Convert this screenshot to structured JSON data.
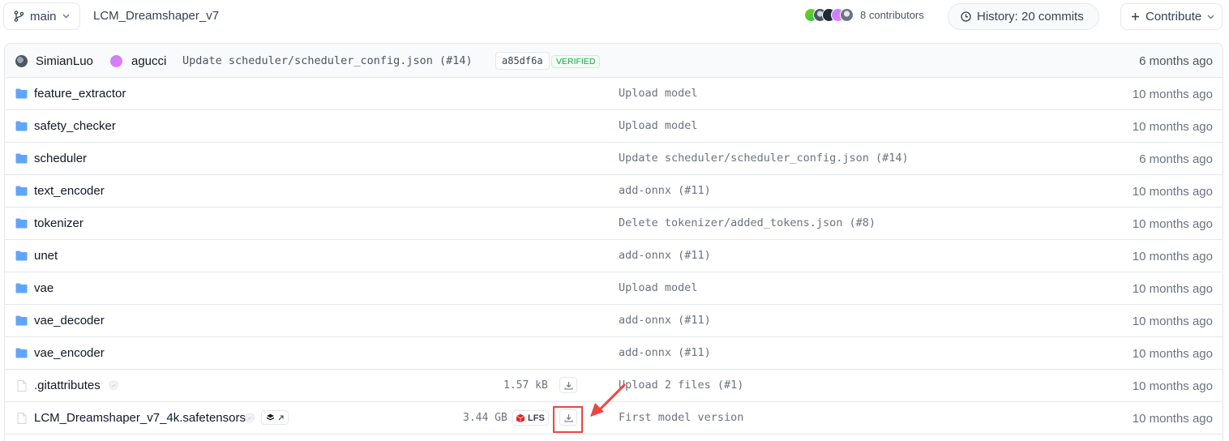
{
  "header": {
    "branch": "main",
    "repo_name": "LCM_Dreamshaper_v7",
    "contributors": "8 contributors",
    "contributor_avatar_colors": [
      "#84cc16",
      "#6b7280",
      "#374151",
      "#c084fc",
      "#6b7280"
    ],
    "history": "History: 20 commits",
    "contribute": "Contribute"
  },
  "last_commit": {
    "author1": "SimianLuo",
    "author2": "agucci",
    "message": "Update scheduler/scheduler_config.json (#14)",
    "hash": "a85df6a",
    "verified": "VERIFIED",
    "time": "6 months ago"
  },
  "folders": [
    {
      "name": "feature_extractor",
      "message": "Upload model",
      "time": "10 months ago"
    },
    {
      "name": "safety_checker",
      "message": "Upload model",
      "time": "10 months ago"
    },
    {
      "name": "scheduler",
      "message": "Update scheduler/scheduler_config.json (#14)",
      "time": "6 months ago"
    },
    {
      "name": "text_encoder",
      "message": "add-onnx (#11)",
      "time": "10 months ago"
    },
    {
      "name": "tokenizer",
      "message": "Delete tokenizer/added_tokens.json (#8)",
      "time": "10 months ago"
    },
    {
      "name": "unet",
      "message": "add-onnx (#11)",
      "time": "10 months ago"
    },
    {
      "name": "vae",
      "message": "Upload model",
      "time": "10 months ago"
    },
    {
      "name": "vae_decoder",
      "message": "add-onnx (#11)",
      "time": "10 months ago"
    },
    {
      "name": "vae_encoder",
      "message": "add-onnx (#11)",
      "time": "10 months ago"
    }
  ],
  "files": [
    {
      "name": ".gitattributes",
      "size": "1.57 kB",
      "message": "Upload 2 files (#1)",
      "time": "10 months ago"
    },
    {
      "name": "LCM_Dreamshaper_v7_4k.safetensors",
      "size": "3.44 GB",
      "lfs": "LFS",
      "message": "First model version",
      "time": "10 months ago"
    }
  ],
  "colors": {
    "folder": "#60a5fa",
    "highlight": "#ef4444",
    "lfs_icon": "#dc2626"
  }
}
